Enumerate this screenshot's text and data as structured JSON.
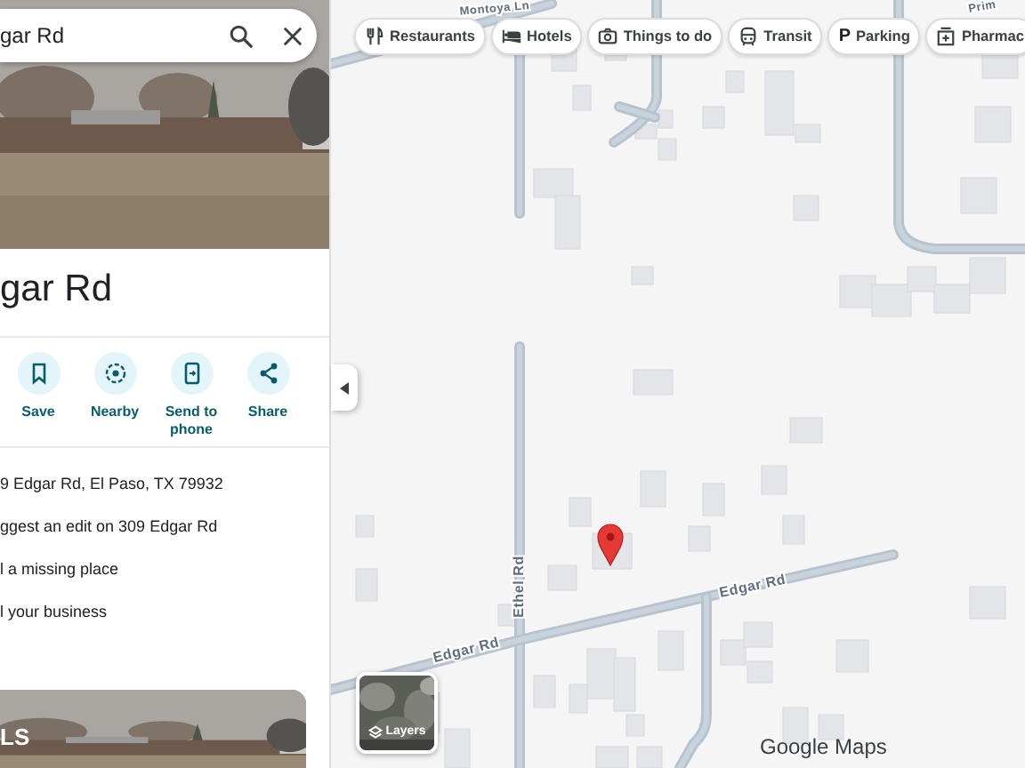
{
  "search": {
    "value": "gar Rd"
  },
  "place": {
    "title": "gar Rd"
  },
  "actions": [
    {
      "kind": "save",
      "label": "Save"
    },
    {
      "kind": "nearby",
      "label": "Nearby"
    },
    {
      "kind": "phone",
      "label": "Send to phone"
    },
    {
      "kind": "share",
      "label": "Share"
    }
  ],
  "info_rows": [
    "9 Edgar Rd, El Paso, TX 79932",
    "ggest an edit on 309 Edgar Rd",
    "l a missing place",
    "l your business"
  ],
  "photo_card": {
    "label": "LS"
  },
  "chips": [
    {
      "kind": "restaurants",
      "label": "Restaurants"
    },
    {
      "kind": "hotels",
      "label": "Hotels"
    },
    {
      "kind": "things",
      "label": "Things to do"
    },
    {
      "kind": "transit",
      "label": "Transit"
    },
    {
      "kind": "parking",
      "glyph": "P",
      "label": "Parking"
    },
    {
      "kind": "pharmacy",
      "label": "Pharmac"
    }
  ],
  "map_labels": [
    {
      "kind": "ethel",
      "text": "Ethel Rd"
    },
    {
      "kind": "edgar_west",
      "text": "Edgar Rd"
    },
    {
      "kind": "edgar_east",
      "text": "Edgar Rd"
    },
    {
      "kind": "montoya",
      "text": "Montoya Ln"
    },
    {
      "kind": "prim",
      "text": "Prim"
    }
  ],
  "layers": {
    "label": "Layers"
  },
  "brand": "Google Maps"
}
